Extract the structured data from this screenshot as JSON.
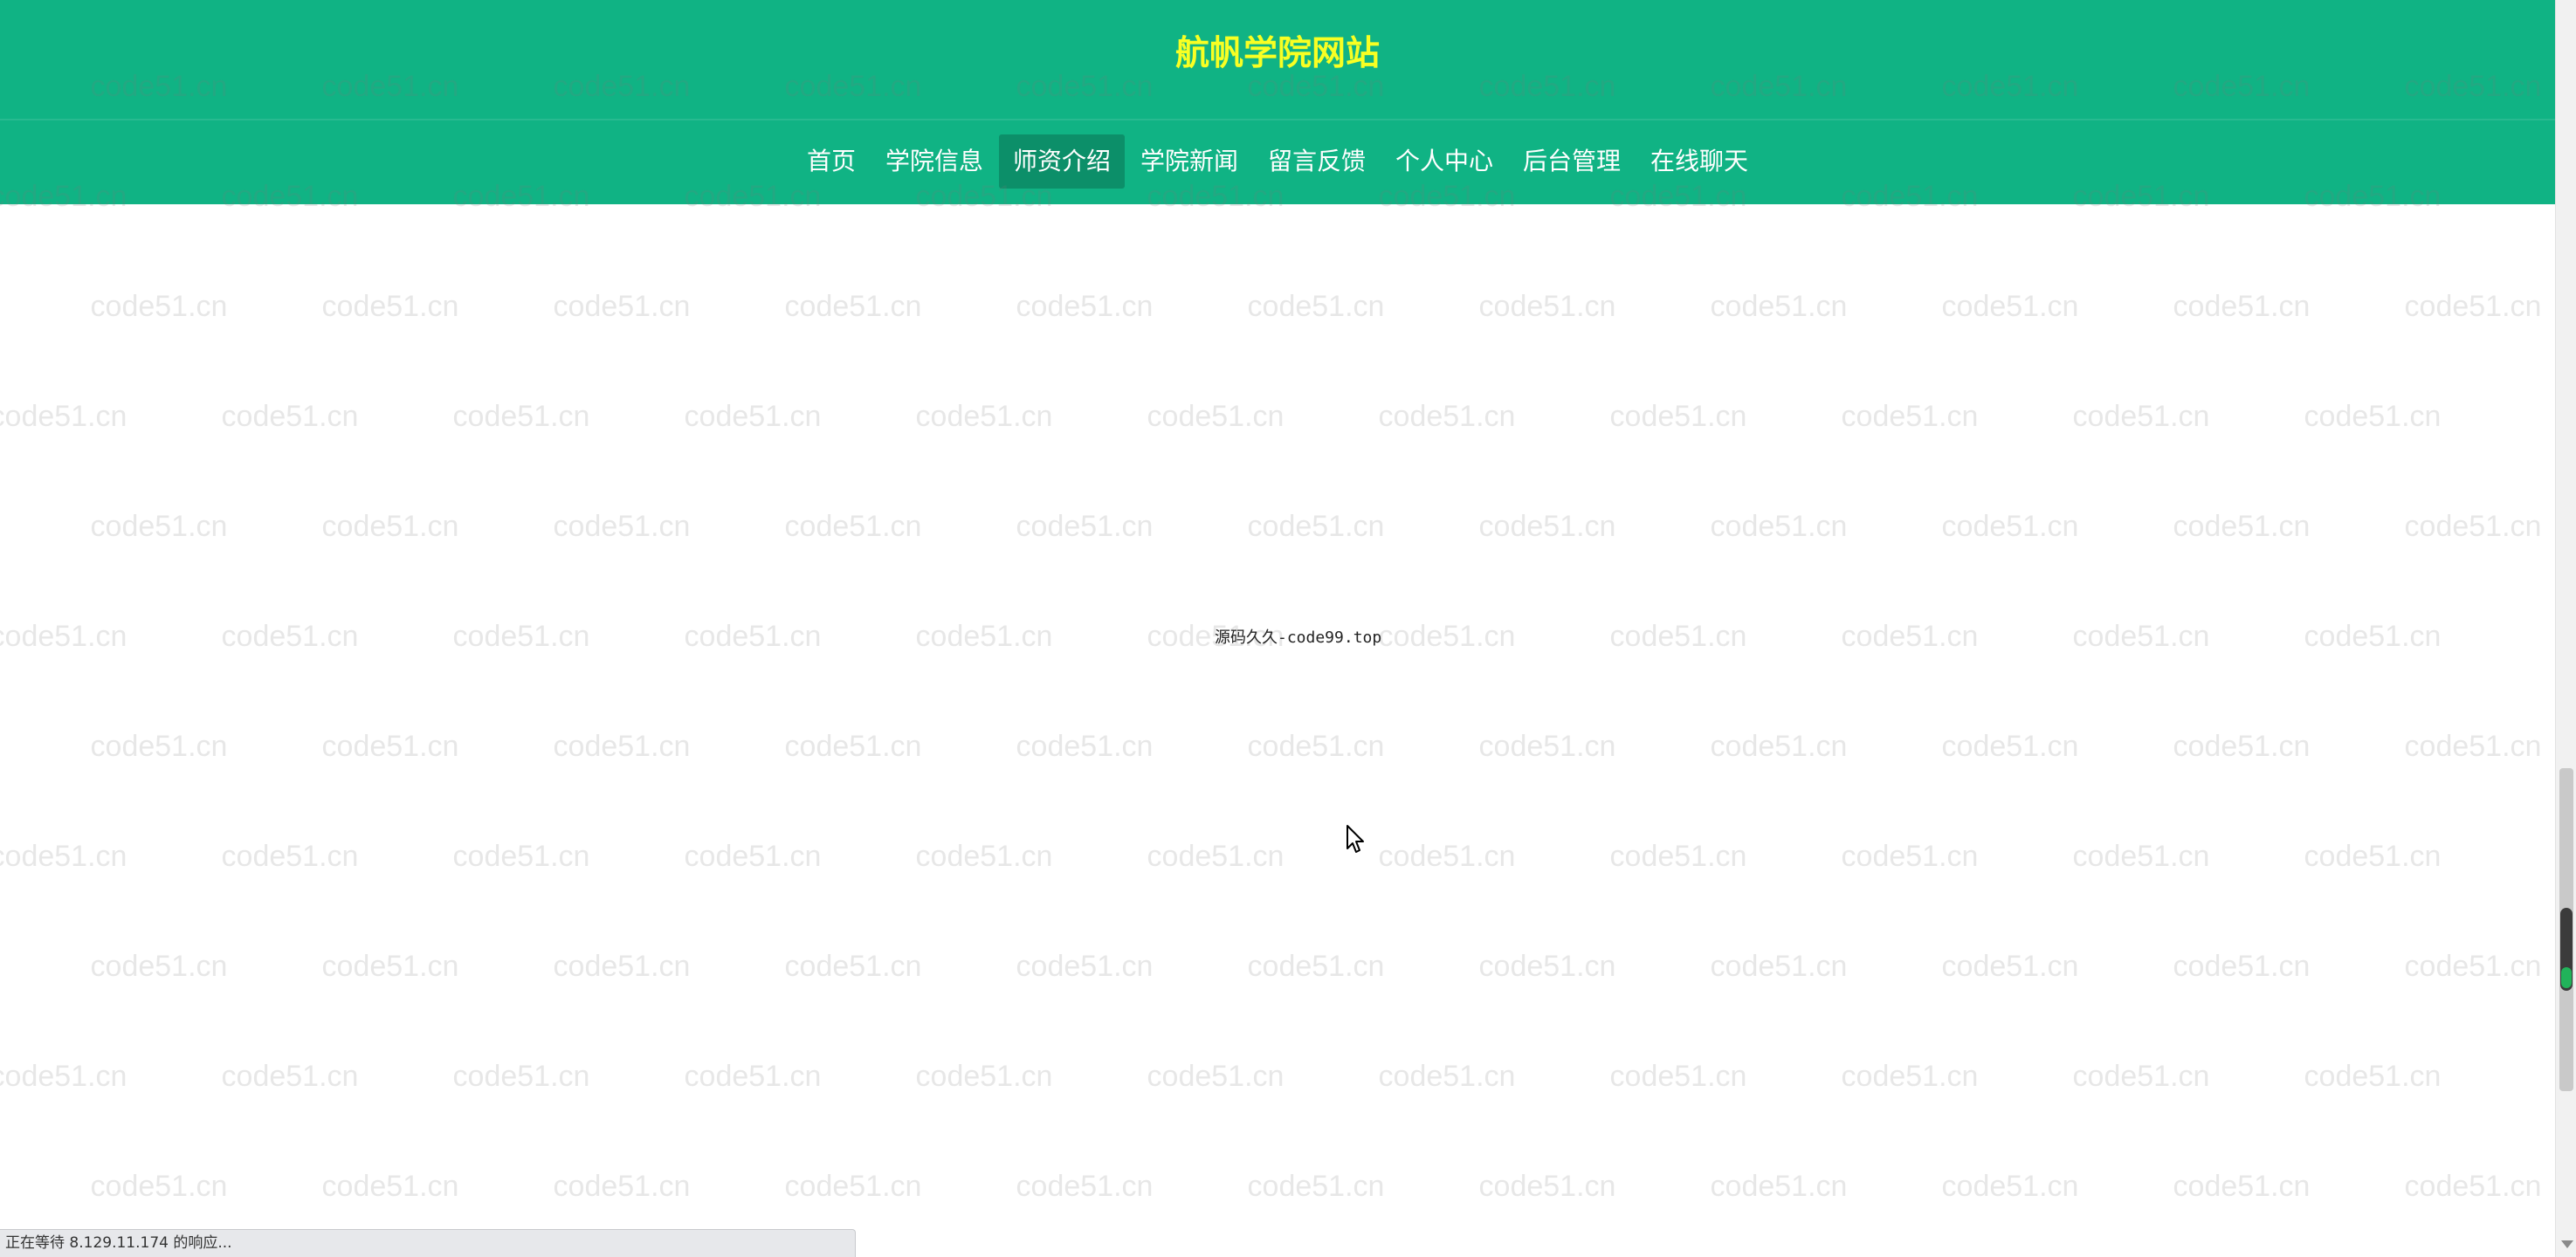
{
  "header": {
    "title": "航帆学院网站",
    "nav": [
      {
        "label": "首页",
        "active": false
      },
      {
        "label": "学院信息",
        "active": false
      },
      {
        "label": "师资介绍",
        "active": true
      },
      {
        "label": "学院新闻",
        "active": false
      },
      {
        "label": "留言反馈",
        "active": false
      },
      {
        "label": "个人中心",
        "active": false
      },
      {
        "label": "后台管理",
        "active": false
      },
      {
        "label": "在线聊天",
        "active": false
      }
    ]
  },
  "main": {
    "center_text": "源码久久-code99.top"
  },
  "watermark": {
    "text": "code51.cn"
  },
  "status_bar": {
    "text": "正在等待 8.129.11.174 的响应..."
  },
  "colors": {
    "header_bg": "#10b384",
    "title": "#f8ff23",
    "nav_active_bg": "#0c8f69",
    "nav_text": "#ffffff"
  }
}
